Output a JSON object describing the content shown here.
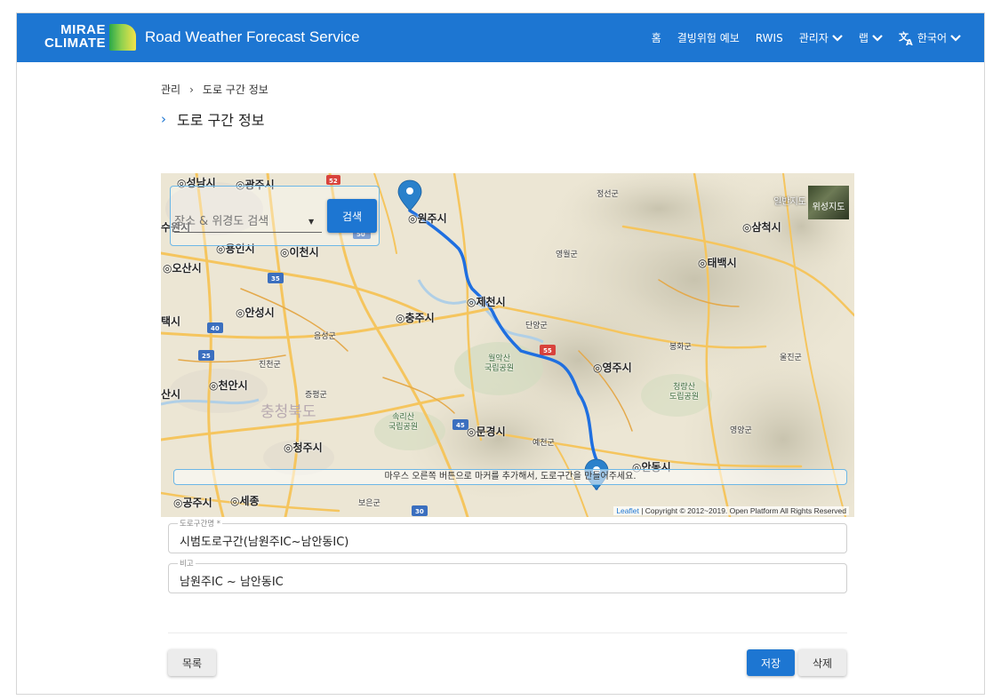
{
  "header": {
    "logo_line1": "MIRAE",
    "logo_line2": "CLIMATE",
    "title": "Road Weather Forecast Service",
    "nav": [
      {
        "label": "홈"
      },
      {
        "label": "결빙위험 예보"
      },
      {
        "label": "RWIS"
      },
      {
        "label": "관리자"
      },
      {
        "label": "랩"
      },
      {
        "label": "한국어"
      }
    ]
  },
  "breadcrumb": {
    "root": "관리",
    "current": "도로 구간 정보"
  },
  "page_title": "도로 구간 정보",
  "map": {
    "search_placeholder": "장소 & 위경도 검색",
    "search_button": "검색",
    "layer_normal": "일반지도",
    "layer_satellite": "위성지도",
    "hint": "마우스 오른쪽 버튼으로 마커를 추가해서, 도로구간을 만들어주세요.",
    "attribution_leaflet": "Leaflet",
    "attribution_rest": "| Copyright © 2012~2019. Open Platform All Rights Reserved",
    "labels": {
      "seongnam": "성남시",
      "gwangju": "광주시",
      "suwon": "수원시",
      "yongin": "용인시",
      "icheon": "이천시",
      "osan": "오산시",
      "anseong": "안성시",
      "pyeongtaek": "택시",
      "chungju": "충주시",
      "jecheon": "제천시",
      "wonju": "원주시",
      "cheonan": "천안시",
      "cheongju": "청주시",
      "sejong": "세종",
      "gongju": "공주시",
      "asan": "산시",
      "mungyeong": "문경시",
      "yeongju": "영주시",
      "andong": "안동시",
      "taebaek": "태백시",
      "samcheok": "삼척시",
      "jeongseon": "정선군",
      "yeongwol": "영월군",
      "danyang": "단양군",
      "bonghwa": "봉화군",
      "uljin": "울진군",
      "yeongyang": "영양군",
      "yecheon": "예천군",
      "eumseong": "음성군",
      "jincheon": "진천군",
      "jeungpyeong": "증평군",
      "boeun": "보은군",
      "chungbuk": "충청북도",
      "woraksan": "월악산\n국립공원",
      "songnisan": "속리산\n국립공원",
      "cheongnyangsan": "청량산\n도립공원"
    }
  },
  "form": {
    "road_name_label": "도로구간명 *",
    "road_name_value": "시범도로구간(남원주IC~남안동IC)",
    "note_label": "비고",
    "note_value": "남원주IC ~ 남안동IC"
  },
  "buttons": {
    "list": "목록",
    "save": "저장",
    "delete": "삭제"
  },
  "colors": {
    "primary": "#1d76d2",
    "route": "#1f6fe0",
    "marker": "#2a81cb"
  }
}
